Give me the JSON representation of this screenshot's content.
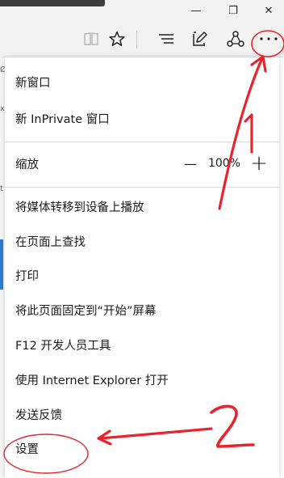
{
  "window": {
    "minimize_glyph": "—",
    "maximize_glyph": "❐",
    "close_glyph": "✕"
  },
  "toolbar": {
    "icons": [
      "reading-view-icon",
      "favorites-star-icon",
      "hub-icon",
      "web-note-icon",
      "share-icon",
      "more-actions-icon"
    ]
  },
  "page_fragments": [
    "Ø",
    "x",
    "t"
  ],
  "menu": {
    "new_window": "新窗口",
    "new_inprivate": "新 InPrivate 窗口",
    "zoom_label": "缩放",
    "zoom_out": "—",
    "zoom_value": "100%",
    "zoom_in": "+",
    "cast_media": "将媒体转移到设备上播放",
    "find_on_page": "在页面上查找",
    "print": "打印",
    "pin_to_start": "将此页面固定到“开始”屏幕",
    "f12_tools": "F12 开发人员工具",
    "open_with_ie": "使用 Internet Explorer 打开",
    "send_feedback": "发送反馈",
    "settings": "设置"
  },
  "annotations": {
    "color": "#e8242c",
    "step_one": "1",
    "step_two": "2"
  }
}
